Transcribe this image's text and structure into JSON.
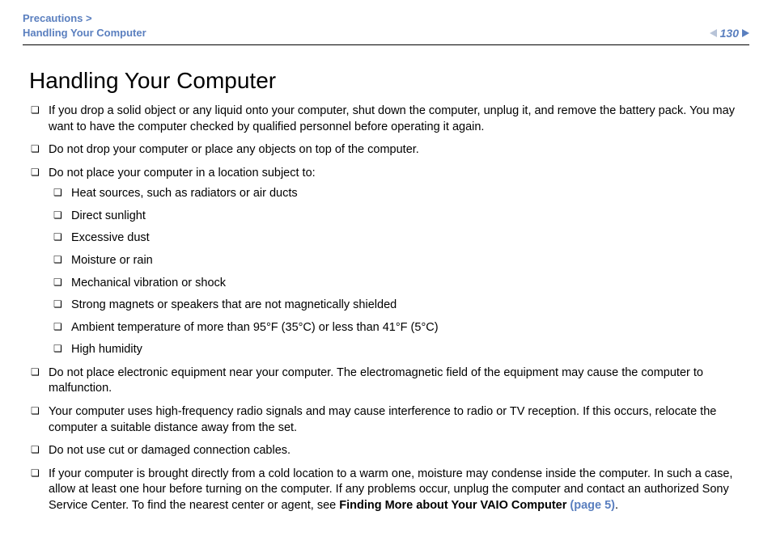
{
  "header": {
    "breadcrumb_line1": "Precautions >",
    "breadcrumb_line2": "Handling Your Computer",
    "page_number": "130"
  },
  "title": "Handling Your Computer",
  "items": [
    {
      "text": "If you drop a solid object or any liquid onto your computer, shut down the computer, unplug it, and remove the battery pack. You may want to have the computer checked by qualified personnel before operating it again."
    },
    {
      "text": "Do not drop your computer or place any objects on top of the computer."
    },
    {
      "text": "Do not place your computer in a location subject to:",
      "sub": [
        "Heat sources, such as radiators or air ducts",
        "Direct sunlight",
        "Excessive dust",
        "Moisture or rain",
        "Mechanical vibration or shock",
        "Strong magnets or speakers that are not magnetically shielded",
        "Ambient temperature of more than 95°F (35°C) or less than 41°F (5°C)",
        "High humidity"
      ]
    },
    {
      "text": "Do not place electronic equipment near your computer. The electromagnetic field of the equipment may cause the computer to malfunction."
    },
    {
      "text": "Your computer uses high-frequency radio signals and may cause interference to radio or TV reception. If this occurs, relocate the computer a suitable distance away from the set."
    },
    {
      "text": "Do not use cut or damaged connection cables."
    },
    {
      "text_parts": {
        "pre": "If your computer is brought directly from a cold location to a warm one, moisture may condense inside the computer. In such a case, allow at least one hour before turning on the computer. If any problems occur, unplug the computer and contact an authorized Sony Service Center. To find the nearest center or agent, see ",
        "bold": "Finding More about Your VAIO Computer ",
        "link": "(page 5)",
        "post": "."
      }
    }
  ]
}
